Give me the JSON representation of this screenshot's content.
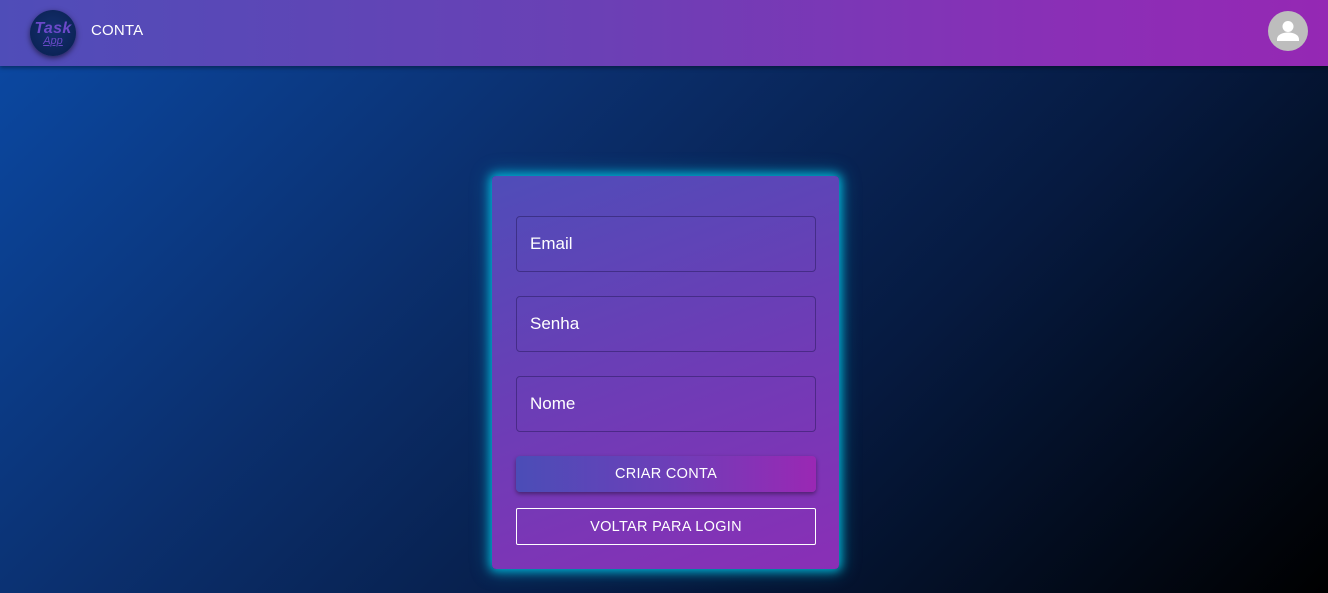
{
  "header": {
    "logo": {
      "line1": "Task",
      "line2": "App"
    },
    "title": "CONTA",
    "avatar_icon": "user-avatar-icon"
  },
  "form": {
    "email": {
      "placeholder": "Email"
    },
    "password": {
      "placeholder": "Senha"
    },
    "name": {
      "placeholder": "Nome"
    },
    "create_button_label": "CRIAR CONTA",
    "back_button_label": "VOLTAR PARA LOGIN"
  },
  "colors": {
    "accent_glow": "#00c8e6",
    "header_start": "#4f4db8",
    "header_end": "#9528b4",
    "avatar_bg": "#bdbdbd"
  }
}
